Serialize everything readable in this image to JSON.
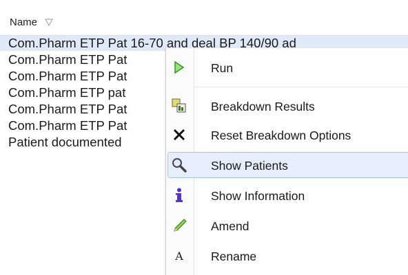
{
  "header": {
    "column_label": "Name",
    "sort_icon": "filter-triangle-icon"
  },
  "list": {
    "items": [
      {
        "label": "Com.Pharm ETP Pat 16-70 and deal BP 140/90 ad"
      },
      {
        "label": "Com.Pharm ETP Pat"
      },
      {
        "label": "Com.Pharm ETP Pat"
      },
      {
        "label": "Com.Pharm ETP pat"
      },
      {
        "label": "Com.Pharm ETP Pat"
      },
      {
        "label": "Com.Pharm ETP Pat"
      },
      {
        "label": "Patient documented"
      }
    ]
  },
  "context_menu": {
    "items": [
      {
        "label": "Run",
        "icon": "play-icon"
      },
      {
        "label": "Breakdown Results",
        "icon": "breakdown-icon"
      },
      {
        "label": "Reset Breakdown Options",
        "icon": "close-icon"
      },
      {
        "label": "Show Patients",
        "icon": "magnifier-icon"
      },
      {
        "label": "Show Information",
        "icon": "info-icon"
      },
      {
        "label": "Amend",
        "icon": "pencil-icon"
      },
      {
        "label": "Rename",
        "icon": "rename-icon"
      }
    ]
  },
  "colors": {
    "selection": "#dfe9f7",
    "highlight_fill": "#e6eefb",
    "highlight_border": "#a9c3e8",
    "info_icon": "#5533cc",
    "play_icon": "#33bb22"
  }
}
